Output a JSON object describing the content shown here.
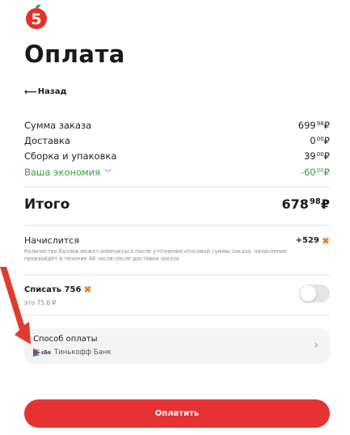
{
  "header": {
    "title": "Оплата",
    "back_label": "Назад"
  },
  "summary": {
    "rows": [
      {
        "label": "Сумма заказа",
        "int": "699",
        "dec": "98",
        "cur": "₽"
      },
      {
        "label": "Доставка",
        "int": "0",
        "dec": "00",
        "cur": "₽"
      },
      {
        "label": "Сборка и упаковка",
        "int": "39",
        "dec": "00",
        "cur": "₽"
      }
    ],
    "savings": {
      "label": "Ваша экономия",
      "int": "-60",
      "dec": "00",
      "cur": "₽"
    }
  },
  "total": {
    "label": "Итого",
    "int": "678",
    "dec": "98",
    "cur": "₽"
  },
  "accrual": {
    "label": "Начислится",
    "value": "+529",
    "note": "Количество баллов может измениться после уточнения итоговой суммы заказа, начисление произойдет в течение 48 часов после доставки заказа"
  },
  "write_off": {
    "label": "Списать 756",
    "sub": "это 75.6 ₽",
    "enabled": false
  },
  "payment_method": {
    "label": "Способ оплаты",
    "logo_text": "сбп",
    "bank": "Тинькофф Банк"
  },
  "pay_button": {
    "label": "Оплатить"
  },
  "colors": {
    "brand_red": "#e63232",
    "savings_green": "#3a9d3a",
    "points_orange": "#f07a1e"
  }
}
